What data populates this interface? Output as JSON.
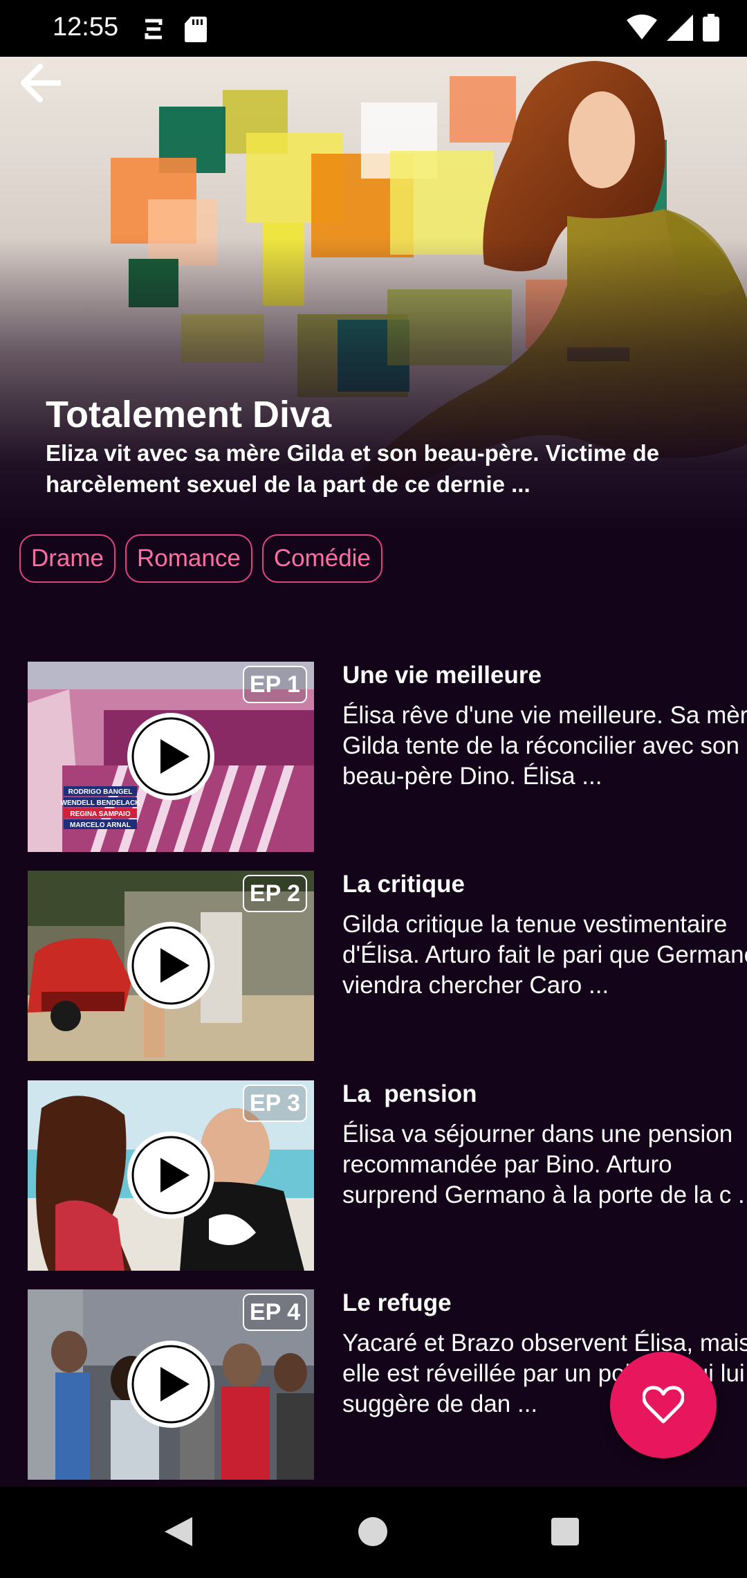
{
  "status_bar": {
    "time": "12:55",
    "icons": [
      "sync-icon",
      "sd-card-icon",
      "wifi-icon",
      "signal-icon",
      "battery-icon"
    ]
  },
  "header": {
    "back_icon": "arrow-left-icon"
  },
  "show": {
    "title": "Totalement Diva",
    "synopsis": "Eliza vit avec sa mère Gilda et son beau-père. Victime de harcèlement sexuel de la part de ce dernie ..."
  },
  "genres": [
    "Drame",
    "Romance",
    "Comédie"
  ],
  "episodes": [
    {
      "badge": "EP 1",
      "title": "Une vie meilleure",
      "description": "Élisa rêve d'une vie meilleure. Sa mère Gilda tente de la réconcilier avec son beau-père Dino. Élisa ...",
      "credits": [
        "RODRIGO BANGEL",
        "WENDELL BENDELACK",
        "REGINA SAMPAIO",
        "MARCELO ARNAL"
      ]
    },
    {
      "badge": "EP 2",
      "title": "La critique",
      "description": "Gilda critique la tenue vestimentaire d'Élisa. Arturo fait le pari que Germano viendra chercher Caro ..."
    },
    {
      "badge": "EP 3",
      "title": "La  pension",
      "description": "Élisa va séjourner dans une pension recommandée par Bino. Arturo surprend Germano à la porte de la c ..."
    },
    {
      "badge": "EP 4",
      "title": "Le refuge",
      "description": "Yacaré et Brazo observent Élisa, mais elle est réveillée par un policier qui lui suggère de dan ..."
    }
  ],
  "fab": {
    "icon": "heart-icon"
  },
  "colors": {
    "background": "#14041a",
    "accent": "#e8175d",
    "chip_border": "#e0457d",
    "chip_text": "#ff6fa3"
  },
  "nav_bar": {
    "icons": [
      "nav-back-icon",
      "nav-home-icon",
      "nav-recents-icon"
    ]
  }
}
